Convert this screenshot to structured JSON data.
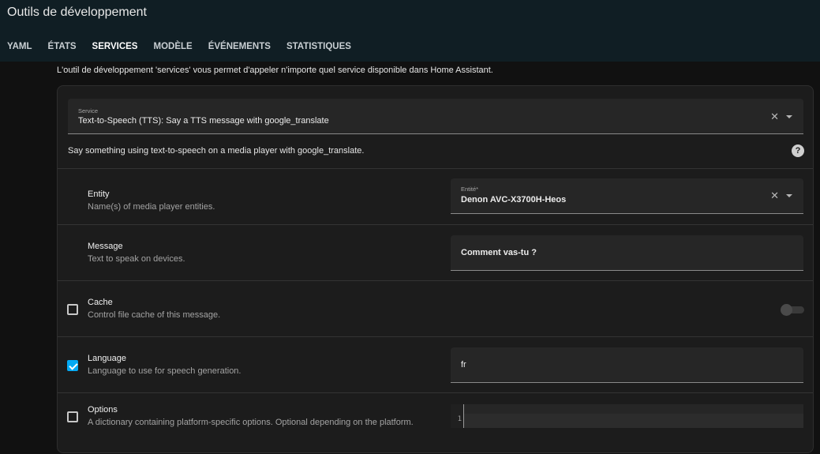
{
  "header": {
    "title": "Outils de développement",
    "tabs": [
      "YAML",
      "ÉTATS",
      "SERVICES",
      "MODÈLE",
      "ÉVÉNEMENTS",
      "STATISTIQUES"
    ],
    "active_tab": "SERVICES"
  },
  "intro_text": "L'outil de développement 'services' vous permet d'appeler n'importe quel service disponible dans Home Assistant.",
  "service": {
    "label": "Service",
    "value": "Text-to-Speech (TTS): Say a TTS message with google_translate",
    "description": "Say something using text-to-speech on a media player with google_translate."
  },
  "fields": {
    "entity": {
      "name": "Entity",
      "description": "Name(s) of media player entities.",
      "input_label": "Entité*",
      "value": "Denon AVC-X3700H-Heos"
    },
    "message": {
      "name": "Message",
      "description": "Text to speak on devices.",
      "value": "Comment vas-tu ?"
    },
    "cache": {
      "name": "Cache",
      "description": "Control file cache of this message.",
      "checked": false,
      "toggle_on": false
    },
    "language": {
      "name": "Language",
      "description": "Language to use for speech generation.",
      "checked": true,
      "value": "fr"
    },
    "options": {
      "name": "Options",
      "description": "A dictionary containing platform-specific options. Optional depending on the platform.",
      "checked": false,
      "line_number": "1"
    }
  },
  "icons": {
    "clear": "close-icon",
    "dropdown": "chevron-down-icon",
    "help": "help-circle-icon"
  },
  "colors": {
    "header_bg": "#101e24",
    "accent": "#03a9f4",
    "card_bg": "#1c1c1c"
  }
}
